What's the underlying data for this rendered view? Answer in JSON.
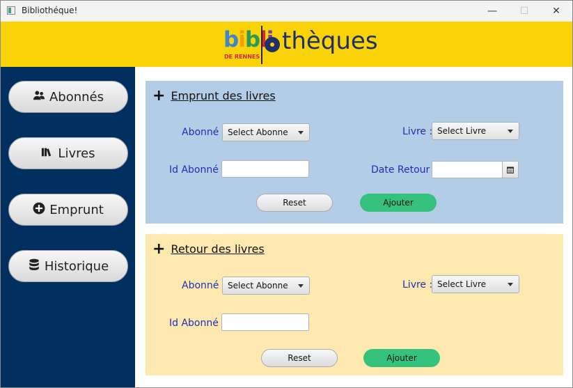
{
  "window": {
    "title": "Bibliothéque!",
    "minimize": "—",
    "maximize": "☐",
    "close": "✕"
  },
  "logo": {
    "biblio_letters": [
      "b",
      "i",
      "b",
      "l",
      "i"
    ],
    "theques": "thèques",
    "subtitle": "DE RENNES"
  },
  "sidebar": {
    "items": [
      {
        "label": "Abonnés",
        "icon": "users-icon"
      },
      {
        "label": "Livres",
        "icon": "books-icon"
      },
      {
        "label": "Emprunt",
        "icon": "plus-circle-icon"
      },
      {
        "label": "Historique",
        "icon": "database-icon"
      }
    ]
  },
  "emprunt": {
    "title": "Emprunt des livres",
    "abonne_label": "Abonné :",
    "abonne_select": "Select Abonne",
    "livre_label": "Livre :",
    "livre_select": "Select Livre",
    "id_abonne_label": "Id Abonné :",
    "id_abonne_value": "",
    "date_retour_label": "Date Retour :",
    "date_retour_value": "",
    "reset": "Reset",
    "ajouter": "Ajouter"
  },
  "retour": {
    "title": "Retour des livres",
    "abonne_label": "Abonné :",
    "abonne_select": "Select Abonne",
    "livre_label": "Livre :",
    "livre_select": "Select Livre",
    "id_abonne_label": "Id Abonné :",
    "id_abonne_value": "",
    "reset": "Reset",
    "ajouter": "Ajouter"
  },
  "colors": {
    "banner": "#f9d308",
    "sidebar": "#013060",
    "panel_emprunt": "#b4cde7",
    "panel_retour": "#fde9b0",
    "label_text": "#1e2fb3",
    "ajouter_button": "#35c27c",
    "biblio_letters": [
      "#3c87c9",
      "#f0a000",
      "#2a9a5a",
      "#d4282a",
      "#7a3fa0"
    ]
  }
}
